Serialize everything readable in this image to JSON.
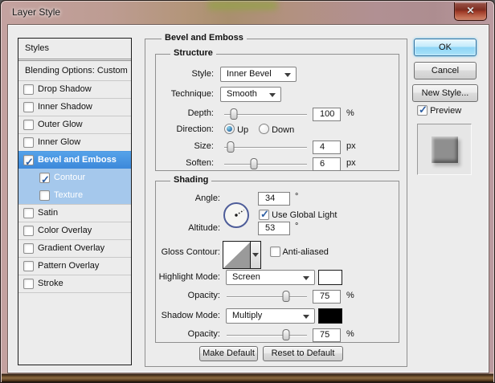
{
  "window": {
    "title": "Layer Style",
    "close_glyph": "✕"
  },
  "sidebar": {
    "header": "Styles",
    "blending": "Blending Options: Custom",
    "items": [
      {
        "label": "Drop Shadow",
        "checked": false,
        "state": "normal"
      },
      {
        "label": "Inner Shadow",
        "checked": false,
        "state": "normal"
      },
      {
        "label": "Outer Glow",
        "checked": false,
        "state": "normal"
      },
      {
        "label": "Inner Glow",
        "checked": false,
        "state": "normal"
      },
      {
        "label": "Bevel and Emboss",
        "checked": true,
        "state": "selected"
      },
      {
        "label": "Contour",
        "checked": true,
        "state": "sub"
      },
      {
        "label": "Texture",
        "checked": false,
        "state": "sub"
      },
      {
        "label": "Satin",
        "checked": false,
        "state": "normal"
      },
      {
        "label": "Color Overlay",
        "checked": false,
        "state": "normal"
      },
      {
        "label": "Gradient Overlay",
        "checked": false,
        "state": "normal"
      },
      {
        "label": "Pattern Overlay",
        "checked": false,
        "state": "normal"
      },
      {
        "label": "Stroke",
        "checked": false,
        "state": "normal"
      }
    ]
  },
  "main": {
    "title": "Bevel and Emboss",
    "structure": {
      "legend": "Structure",
      "style_label": "Style:",
      "style_value": "Inner Bevel",
      "technique_label": "Technique:",
      "technique_value": "Smooth",
      "depth_label": "Depth:",
      "depth_value": "100",
      "depth_unit": "%",
      "direction_label": "Direction:",
      "direction_up": "Up",
      "direction_down": "Down",
      "direction_selected": "Up",
      "size_label": "Size:",
      "size_value": "4",
      "size_unit": "px",
      "soften_label": "Soften:",
      "soften_value": "6",
      "soften_unit": "px"
    },
    "shading": {
      "legend": "Shading",
      "angle_label": "Angle:",
      "angle_value": "34",
      "angle_unit": "°",
      "use_global_light": "Use Global Light",
      "use_global_light_checked": true,
      "altitude_label": "Altitude:",
      "altitude_value": "53",
      "altitude_unit": "°",
      "gloss_label": "Gloss Contour:",
      "anti_aliased": "Anti-aliased",
      "anti_aliased_checked": false,
      "highlight_label": "Highlight Mode:",
      "highlight_value": "Screen",
      "opacity1_label": "Opacity:",
      "opacity1_value": "75",
      "opacity1_unit": "%",
      "shadow_label": "Shadow Mode:",
      "shadow_value": "Multiply",
      "opacity2_label": "Opacity:",
      "opacity2_value": "75",
      "opacity2_unit": "%"
    },
    "footer": {
      "make_default": "Make Default",
      "reset_default": "Reset to Default"
    }
  },
  "actions": {
    "ok": "OK",
    "cancel": "Cancel",
    "new_style": "New Style...",
    "preview": "Preview"
  },
  "sliders": {
    "depth": 12,
    "size": 8,
    "soften": 36,
    "opacity_highlight": 74,
    "opacity_shadow": 74
  },
  "colors": {
    "highlight_swatch": "#ffffff",
    "shadow_swatch": "#000000",
    "selected_row": "#3f90e0",
    "sub_row": "#a5c8ec"
  }
}
